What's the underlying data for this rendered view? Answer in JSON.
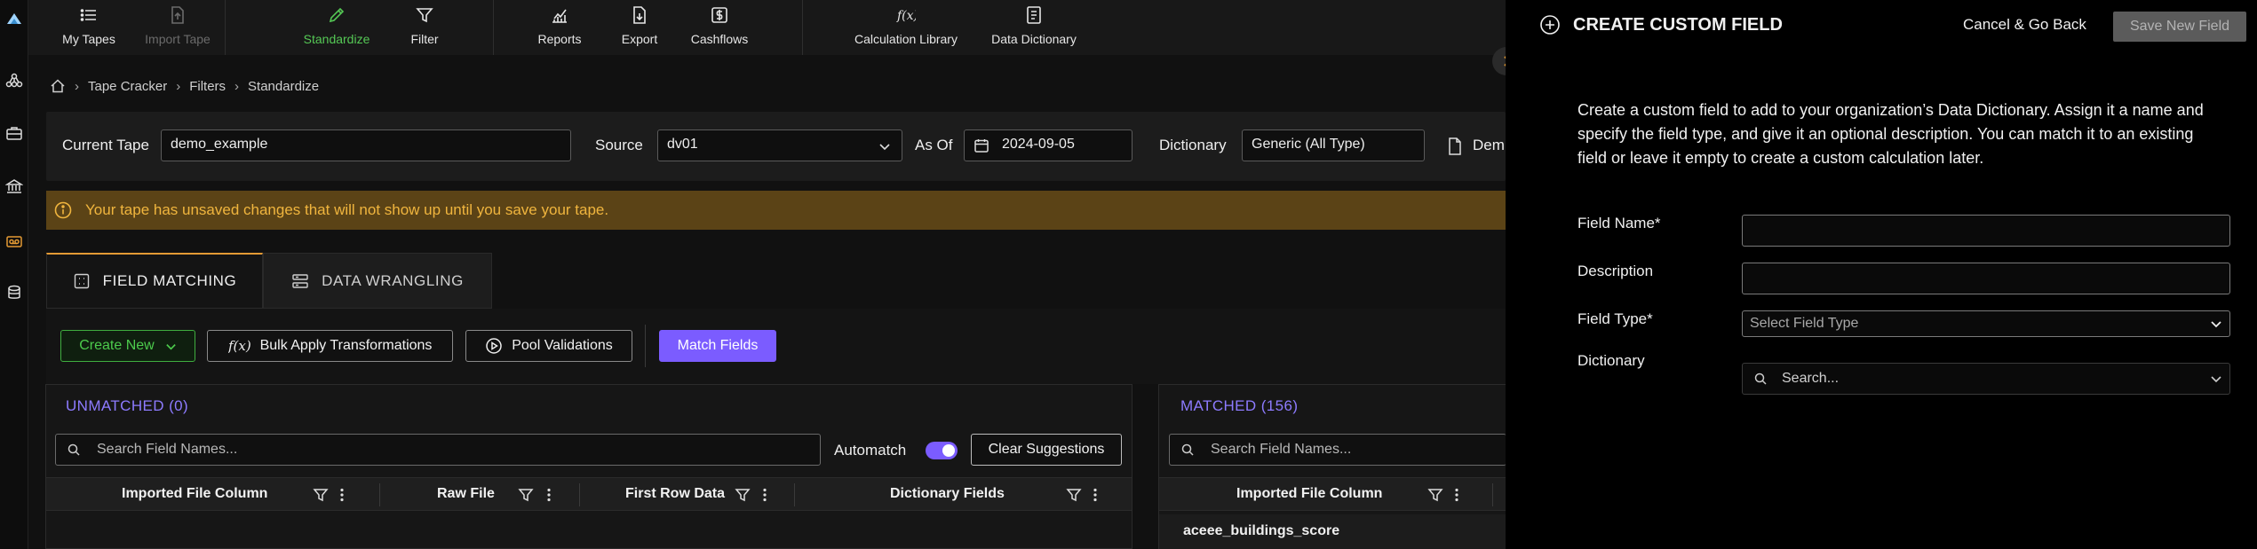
{
  "toolbar": {
    "my_tapes": "My Tapes",
    "import_tape": "Import Tape",
    "standardize": "Standardize",
    "filter": "Filter",
    "reports": "Reports",
    "export": "Export",
    "cashflows": "Cashflows",
    "calculation_library": "Calculation Library",
    "data_dictionary": "Data Dictionary"
  },
  "breadcrumb": {
    "items": [
      "Tape Cracker",
      "Filters",
      "Standardize"
    ]
  },
  "tapebar": {
    "current_tape_label": "Current Tape",
    "current_tape_value": "demo_example",
    "source_label": "Source",
    "source_value": "dv01",
    "as_of_label": "As Of",
    "as_of_value": "2024-09-05",
    "dictionary_label": "Dictionary",
    "dictionary_value": "Generic (All Type)",
    "truncated_label": "Dem"
  },
  "warning": {
    "text": "Your tape has unsaved changes that will not show up until you save your tape."
  },
  "tabs": {
    "field_matching": "FIELD MATCHING",
    "data_wrangling": "DATA WRANGLING"
  },
  "actions": {
    "create_new": "Create New",
    "bulk_apply": "Bulk Apply Transformations",
    "pool_validations": "Pool Validations",
    "match_fields": "Match Fields"
  },
  "unmatched": {
    "title": "UNMATCHED (0)",
    "search_placeholder": "Search Field Names...",
    "automatch_label": "Automatch",
    "clear_suggestions": "Clear Suggestions",
    "columns": [
      "Imported File Column",
      "Raw File",
      "First Row Data",
      "Dictionary Fields"
    ]
  },
  "matched": {
    "title": "MATCHED (156)",
    "search_placeholder": "Search Field Names...",
    "columns": [
      "Imported File Column"
    ],
    "first_row": "aceee_buildings_score"
  },
  "drawer": {
    "title": "CREATE CUSTOM FIELD",
    "cancel": "Cancel & Go Back",
    "save": "Save New Field",
    "description": "Create a custom field to add to your organization’s Data Dictionary. Assign it a name and specify the field type, and give it an optional description. You can match it to an existing field or leave it empty to create a custom calculation later.",
    "field_name_label": "Field Name*",
    "description_label": "Description",
    "field_type_label": "Field Type*",
    "field_type_placeholder": "Select Field Type",
    "dictionary_label": "Dictionary",
    "dictionary_placeholder": "Search..."
  },
  "colors": {
    "accent_purple": "#7b5cff",
    "accent_green": "#4ccb4c",
    "warning_bg": "#5b4316",
    "warning_text": "#f0b53e",
    "tab_active_border": "#e39a34"
  }
}
